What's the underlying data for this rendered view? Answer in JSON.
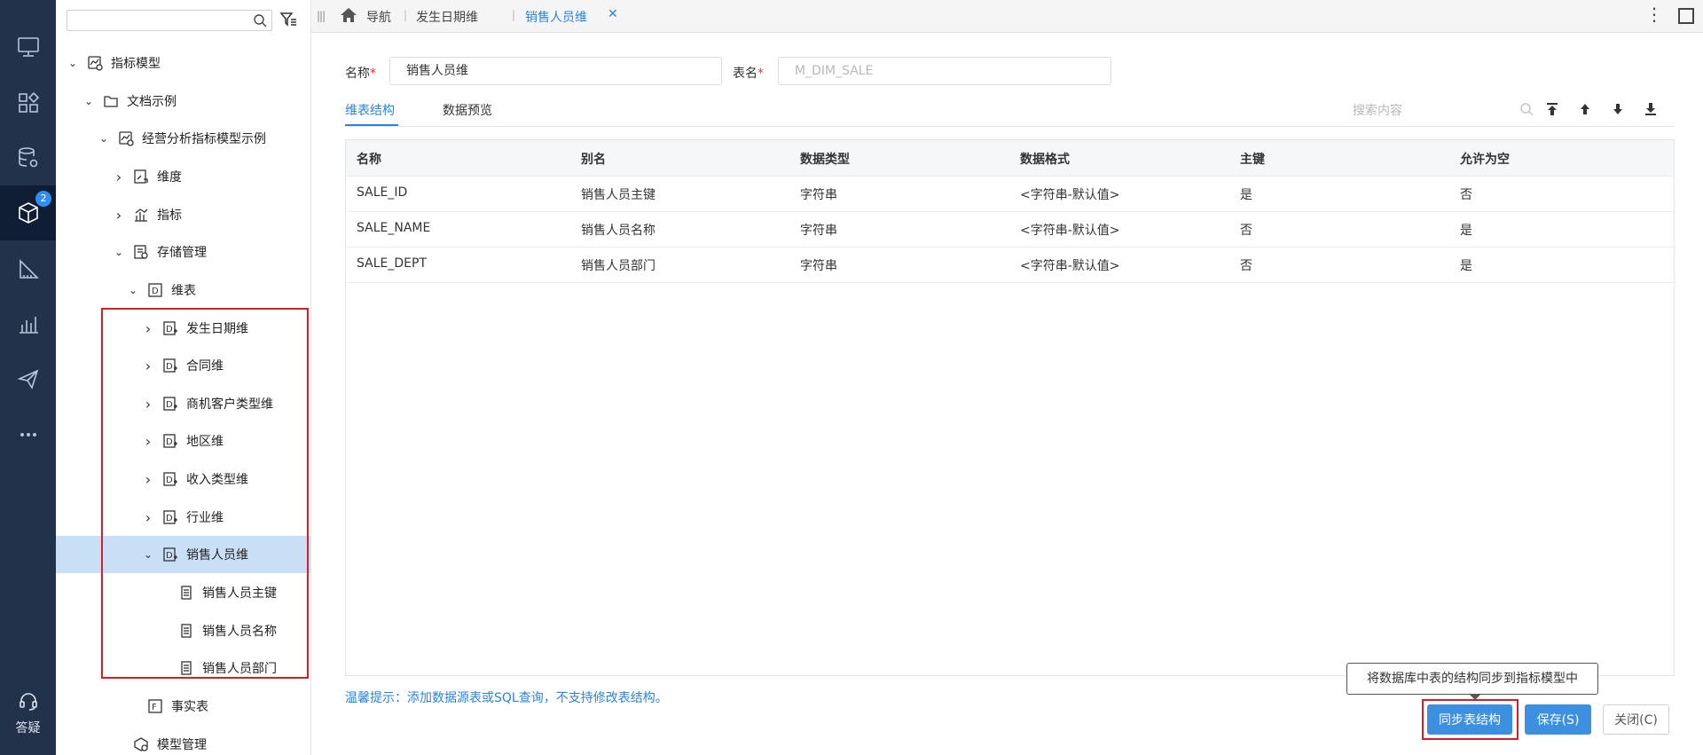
{
  "rail": {
    "items": [
      {
        "name": "desktop-icon"
      },
      {
        "name": "apps-icon"
      },
      {
        "name": "database-settings-icon"
      },
      {
        "name": "cube-icon",
        "badge": "2"
      },
      {
        "name": "ruler-icon"
      },
      {
        "name": "bar-chart-icon"
      },
      {
        "name": "send-icon"
      },
      {
        "name": "more-icon"
      }
    ],
    "help_label": "答疑"
  },
  "tree": {
    "search_placeholder": "",
    "nodes": [
      {
        "label": "指标模型",
        "arrow": "open",
        "icon": "metric-model-icon"
      },
      {
        "label": "文档示例",
        "arrow": "open",
        "icon": "folder-icon"
      },
      {
        "label": "经营分析指标模型示例",
        "arrow": "open",
        "icon": "metric-model-icon"
      },
      {
        "label": "维度",
        "arrow": "closed",
        "icon": "dimension-icon"
      },
      {
        "label": "指标",
        "arrow": "closed",
        "icon": "metric-chart-icon"
      },
      {
        "label": "存储管理",
        "arrow": "open",
        "icon": "storage-icon"
      },
      {
        "label": "维表",
        "arrow": "open",
        "icon": "dimension-table-icon"
      },
      {
        "label": "发生日期维",
        "arrow": "closed",
        "icon": "dim-table-item-icon"
      },
      {
        "label": "合同维",
        "arrow": "closed",
        "icon": "dim-table-item-icon"
      },
      {
        "label": "商机客户类型维",
        "arrow": "closed",
        "icon": "dim-table-item-icon"
      },
      {
        "label": "地区维",
        "arrow": "closed",
        "icon": "dim-table-item-icon"
      },
      {
        "label": "收入类型维",
        "arrow": "closed",
        "icon": "dim-table-item-icon"
      },
      {
        "label": "行业维",
        "arrow": "closed",
        "icon": "dim-table-item-icon"
      },
      {
        "label": "销售人员维",
        "arrow": "open",
        "icon": "dim-table-item-icon",
        "selected": true
      },
      {
        "label": "销售人员主键",
        "arrow": "none",
        "icon": "field-icon"
      },
      {
        "label": "销售人员名称",
        "arrow": "none",
        "icon": "field-icon"
      },
      {
        "label": "销售人员部门",
        "arrow": "none",
        "icon": "field-icon"
      },
      {
        "label": "事实表",
        "arrow": "none",
        "icon": "fact-table-icon"
      },
      {
        "label": "模型管理",
        "arrow": "none",
        "icon": "model-manage-icon"
      }
    ]
  },
  "topbar": {
    "home_label": "导航",
    "tabs": [
      "发生日期维",
      "销售人员维"
    ],
    "close_symbol": "✕"
  },
  "form": {
    "name_label": "名称",
    "required_mark": "*",
    "name_value": "销售人员维",
    "table_label": "表名",
    "table_value": "M_DIM_SALE"
  },
  "tabs": {
    "items": [
      "维表结构",
      "数据预览"
    ],
    "search_placeholder": "搜索内容"
  },
  "grid": {
    "columns": [
      "名称",
      "别名",
      "数据类型",
      "数据格式",
      "主键",
      "允许为空"
    ],
    "rows": [
      [
        "SALE_ID",
        "销售人员主键",
        "字符串",
        "<字符串-默认值>",
        "是",
        "否"
      ],
      [
        "SALE_NAME",
        "销售人员名称",
        "字符串",
        "<字符串-默认值>",
        "否",
        "是"
      ],
      [
        "SALE_DEPT",
        "销售人员部门",
        "字符串",
        "<字符串-默认值>",
        "否",
        "是"
      ]
    ]
  },
  "footer": {
    "hint": "温馨提示：添加数据源表或SQL查询，不支持修改表结构。",
    "tooltip": "将数据库中表的结构同步到指标模型中",
    "sync_label": "同步表结构",
    "save_label": "保存(S)",
    "close_label": "关闭(C)"
  },
  "colors": {
    "rail_bg": "#23324b",
    "accent": "#2a84d8",
    "highlight": "#d0212b",
    "selected_row": "#c9dff5"
  }
}
